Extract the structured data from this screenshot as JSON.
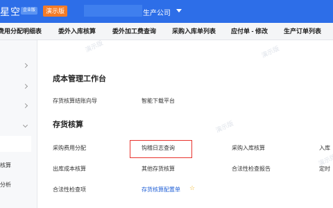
{
  "header": {
    "logo_text": "星空",
    "edition_tag": "企业版",
    "demo_button": "演示版",
    "company_name": "生产公司"
  },
  "tabs": [
    {
      "label": "费用分配明细表"
    },
    {
      "label": "委外入库核算"
    },
    {
      "label": "委外加工费查询"
    },
    {
      "label": "采购入库单列表"
    },
    {
      "label": "应付单 - 修改"
    },
    {
      "label": "生产订单列表"
    }
  ],
  "sidebar": {
    "items": [
      {
        "label": "核算"
      },
      {
        "label": "分析"
      }
    ]
  },
  "watermark": "演示版",
  "main": {
    "section1": {
      "title": "成本管理工作台",
      "links": [
        "存货核算结账向导",
        "智能下载平台"
      ]
    },
    "section2": {
      "title": "存货核算",
      "links": [
        "采购费用分配",
        "钩稽日志查询",
        "采购入库核算",
        "入库",
        "出库成本核算",
        "其他存货核算",
        "合法性检查报告",
        "定时",
        "合法性检查项",
        "存货核算配置单"
      ]
    }
  },
  "colors": {
    "header_bg": "#2d6ee8",
    "demo_btn": "#f47b26",
    "highlight": "#e8322c",
    "link_blue": "#1f5fd6",
    "star": "#f1b31a"
  }
}
